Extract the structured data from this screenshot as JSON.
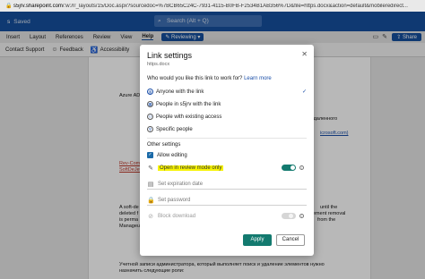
{
  "browser": {
    "url_prefix": "s5jrv.sharepoint.com",
    "url_rest": "/:w:/r/_layouts/15/Doc.aspx?sourcedoc=%7BCB65C24C-7931-4115-B0FB-F2534B1AB356%7D&file=https.docx&action=default&mobileredirect..."
  },
  "word": {
    "title": "s",
    "saved": "Saved",
    "search_placeholder": "Search (Alt + Q)"
  },
  "ribbon_tabs": {
    "items": [
      "Insert",
      "Layout",
      "References",
      "Review",
      "View",
      "Help"
    ],
    "active": "Help",
    "mode_button": "Reviewing",
    "share": "Share"
  },
  "toolbar": {
    "items": [
      "Contact Support",
      "Feedback",
      "Accessibility"
    ]
  },
  "document": {
    "lines": [
      "Azure AD",
      "удаленного",
      "icrosoft.com)",
      "Rev-Com",
      "SoftDeJet",
      "A soft-de",
      "deleted f",
      "is perma",
      "Manageu",
      "Учетной записи администратора, который выполняет поиск и удаление элементов нужно",
      "назначить следующие роли:"
    ],
    "right_fragments": [
      "until the",
      "ement removal",
      "from the"
    ]
  },
  "dialog": {
    "title": "Link settings",
    "subtitle": "https.docx",
    "question": "Who would you like this link to work for?",
    "learn_more": "Learn more",
    "options": [
      {
        "label": "Anyone with the link",
        "icon": "globe-icon",
        "selected": true
      },
      {
        "label": "People in s5jrv with the link",
        "icon": "building-icon",
        "selected": false
      },
      {
        "label": "People with existing access",
        "icon": "people-icon",
        "selected": false
      },
      {
        "label": "Specific people",
        "icon": "person-icon",
        "selected": false
      }
    ],
    "other_settings": "Other settings",
    "allow_editing": "Allow editing",
    "review_mode": "Open in review mode only",
    "review_mode_on": true,
    "expiration": "Set expiration date",
    "password": "Set password",
    "block_download": "Block download",
    "block_download_on": false,
    "apply": "Apply",
    "cancel": "Cancel"
  }
}
